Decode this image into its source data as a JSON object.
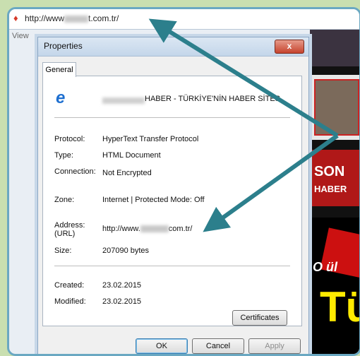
{
  "browser": {
    "address_prefix": "http://www",
    "address_suffix": "t.com.tr/",
    "menu_label": "View"
  },
  "page_content": {
    "son": "SON",
    "haber": "HABER",
    "o_ull": "O ül",
    "tu": "Tü"
  },
  "dialog": {
    "title": "Properties",
    "close_label": "x",
    "tab_general": "General",
    "site_name": "HABER - TÜRKİYE'NİN HABER SİTES",
    "fields": {
      "protocol_label": "Protocol:",
      "protocol_value": "HyperText Transfer Protocol",
      "type_label": "Type:",
      "type_value": "HTML Document",
      "connection_label": "Connection:",
      "connection_value": "Not Encrypted",
      "zone_label": "Zone:",
      "zone_value": "Internet | Protected Mode: Off",
      "address_label": "Address:",
      "address_label2": "(URL)",
      "address_prefix": "http://www.",
      "address_suffix": "com.tr/",
      "size_label": "Size:",
      "size_value": "207090 bytes",
      "created_label": "Created:",
      "created_value": "23.02.2015",
      "modified_label": "Modified:",
      "modified_value": "23.02.2015"
    },
    "certificates_button": "Certificates",
    "ok_button": "OK",
    "cancel_button": "Cancel",
    "apply_button": "Apply"
  },
  "colors": {
    "arrow": "#2c7f8c",
    "frame": "#6aa8c2",
    "background": "#c9dfb0"
  }
}
